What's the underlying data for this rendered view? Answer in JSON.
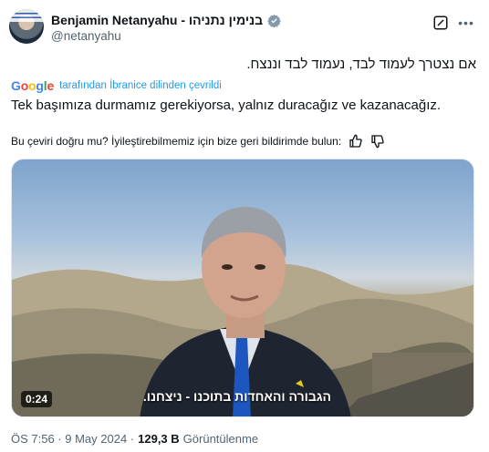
{
  "author": {
    "display_name": "Benjamin Netanyahu - בנימין נתניהו",
    "handle": "@netanyahu"
  },
  "icons": {
    "verified": "verified-badge-icon",
    "grok": "grok-icon",
    "more": "more-options-icon",
    "thumbs_up": "thumbs-up-icon",
    "thumbs_down": "thumbs-down-icon"
  },
  "tweet": {
    "original_text": "אם נצטרך לעמוד לבד, נעמוד לבד וננצח.",
    "translated_by_label": "tarafından İbranice dilinden çevrildi",
    "translation_provider": "Google",
    "translated_text": "Tek başımıza durmamız gerekiyorsa, yalnız duracağız ve kazanacağız.",
    "feedback_prompt": "Bu çeviri doğru mu? İyileştirebilmemiz için bize geri bildirimde bulun:"
  },
  "video": {
    "duration": "0:24",
    "subtitle": "הגבורה והאחדות בתוכנו - ניצחנו."
  },
  "footer": {
    "timestamp": "ÖS 7:56 · 9 May 2024 ·",
    "views_count": "129,3 B",
    "views_label": "Görüntülenme"
  },
  "colors": {
    "accent": "#1d9bf0",
    "secondary_text": "#536471",
    "primary_text": "#0f1419"
  }
}
